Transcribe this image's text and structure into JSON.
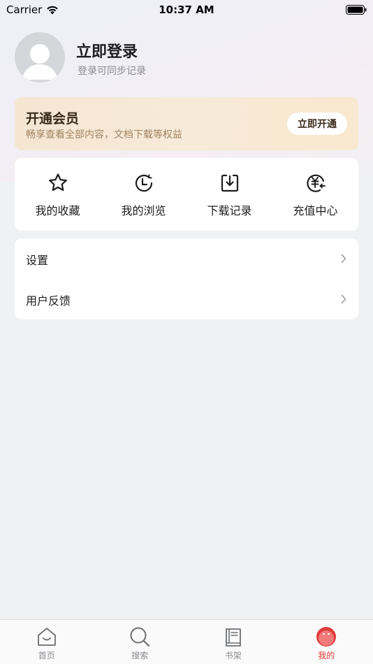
{
  "status_bar": {
    "carrier": "Carrier",
    "time": "10:37 AM"
  },
  "profile": {
    "title": "立即登录",
    "subtitle": "登录可同步记录"
  },
  "vip": {
    "title": "开通会员",
    "subtitle": "畅享查看全部内容，文档下载等权益",
    "button": "立即开通"
  },
  "quick_actions": [
    {
      "label": "我的收藏",
      "icon": "star-icon"
    },
    {
      "label": "我的浏览",
      "icon": "clock-icon"
    },
    {
      "label": "下载记录",
      "icon": "download-icon"
    },
    {
      "label": "充值中心",
      "icon": "yuan-recharge-icon"
    }
  ],
  "menu": [
    {
      "label": "设置"
    },
    {
      "label": "用户反馈"
    }
  ],
  "tabbar": [
    {
      "label": "首页",
      "icon": "home-icon",
      "active": false
    },
    {
      "label": "搜索",
      "icon": "search-icon",
      "active": false
    },
    {
      "label": "书架",
      "icon": "book-icon",
      "active": false
    },
    {
      "label": "我的",
      "icon": "profile-icon",
      "active": true
    }
  ],
  "colors": {
    "accent": "#e03a3a",
    "vip_gradient_start": "#f5e6d2",
    "background": "#f0f1f3"
  }
}
